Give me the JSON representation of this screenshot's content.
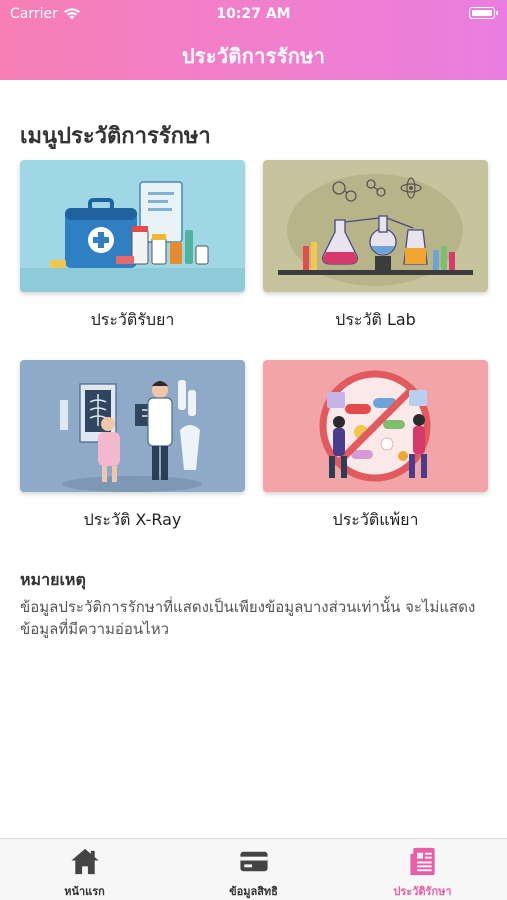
{
  "status_bar": {
    "carrier": "Carrier",
    "time": "10:27 AM"
  },
  "header": {
    "title": "ประวัติการรักษา"
  },
  "menu": {
    "title": "เมนูประวัติการรักษา",
    "items": [
      {
        "label": "ประวัติรับยา",
        "icon": "medicine-kit-illustration"
      },
      {
        "label": "ประวัติ Lab",
        "icon": "lab-flasks-illustration"
      },
      {
        "label": "ประวัติ X-Ray",
        "icon": "xray-doctor-illustration"
      },
      {
        "label": "ประวัติแพ้ยา",
        "icon": "drug-allergy-illustration"
      }
    ]
  },
  "note": {
    "title": "หมายเหตุ",
    "body": "ข้อมูลประวัติการรักษาที่แสดงเป็นเพียงข้อมูลบางส่วนเท่านั้น จะไม่แสดงข้อมูลที่มีความอ่อนไหว"
  },
  "tabbar": {
    "items": [
      {
        "label": "หน้าแรก",
        "icon": "home-icon"
      },
      {
        "label": "ข้อมูลสิทธิ",
        "icon": "card-icon"
      },
      {
        "label": "ประวัติรักษา",
        "icon": "document-icon"
      }
    ],
    "active_index": 2,
    "active_color": "#e85fa8",
    "inactive_color": "#444444"
  },
  "colors": {
    "header_start": "#f77fb5",
    "header_end": "#ea7ee0"
  }
}
